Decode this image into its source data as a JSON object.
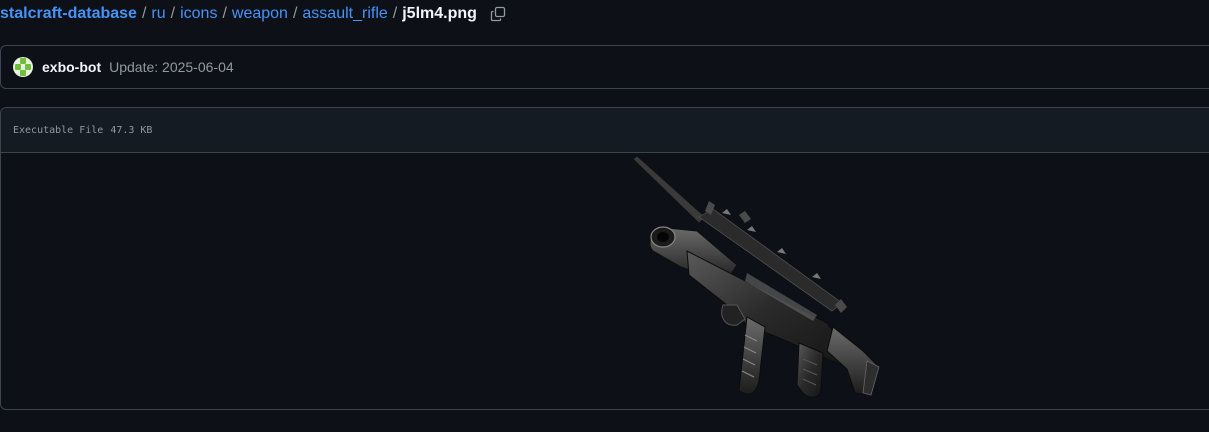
{
  "breadcrumb": {
    "repo": "stalcraft-database",
    "path": [
      "ru",
      "icons",
      "weapon",
      "assault_rifle"
    ],
    "separator": "/",
    "file": "j5lm4.png"
  },
  "commit": {
    "author": "exbo-bot",
    "message": "Update: 2025-06-04"
  },
  "file": {
    "type": "Executable File",
    "size": "47.3 KB"
  },
  "image": {
    "alt": "assault rifle icon"
  },
  "icons": {
    "copy": "copy-icon",
    "avatar": "exbo-bot avatar"
  },
  "colors": {
    "background": "#0d1117",
    "link": "#4493f8",
    "border": "#3d444d",
    "header_bg": "#151b23",
    "muted": "#9198a1"
  }
}
